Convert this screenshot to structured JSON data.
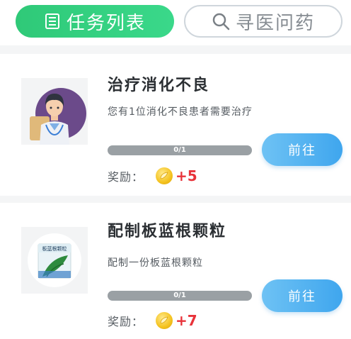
{
  "tabs": {
    "tasks": {
      "label": "任务列表",
      "icon": "list-icon",
      "active": true
    },
    "search": {
      "label": "寻医问药",
      "icon": "search-icon",
      "active": false
    }
  },
  "tasks": [
    {
      "title": "治疗消化不良",
      "description": "您有1位消化不良患者需要治疗",
      "progress_text": "0/1",
      "progress": 0,
      "reward_label": "奖励：",
      "reward_value": "+5",
      "button_label": "前往",
      "image": "doctor-avatar"
    },
    {
      "title": "配制板蓝根颗粒",
      "description": "配制一份板蓝根颗粒",
      "progress_text": "0/1",
      "progress": 0,
      "reward_label": "奖励：",
      "reward_value": "+7",
      "button_label": "前往",
      "image": "medicine-package",
      "package_text": "板蓝根颗粒"
    }
  ],
  "colors": {
    "tab_active": "#2fc978",
    "button": "#4aaaf0",
    "reward_value": "#e8333a"
  }
}
